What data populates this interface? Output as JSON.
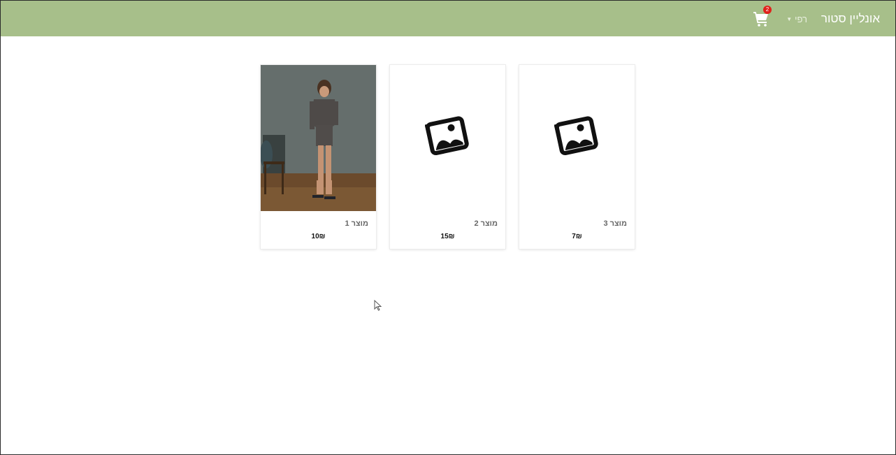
{
  "header": {
    "brand": "אונליין סטור",
    "user_label": "רפי",
    "cart_count": "2"
  },
  "products": [
    {
      "name": "מוצר 1",
      "price": "10₪",
      "image": "photo-model"
    },
    {
      "name": "מוצר 2",
      "price": "15₪",
      "image": "image-placeholder-icon"
    },
    {
      "name": "מוצר 3",
      "price": "7₪",
      "image": "image-placeholder-icon"
    }
  ],
  "colors": {
    "navbar": "#a7bf8a",
    "badge": "#e0211b"
  }
}
